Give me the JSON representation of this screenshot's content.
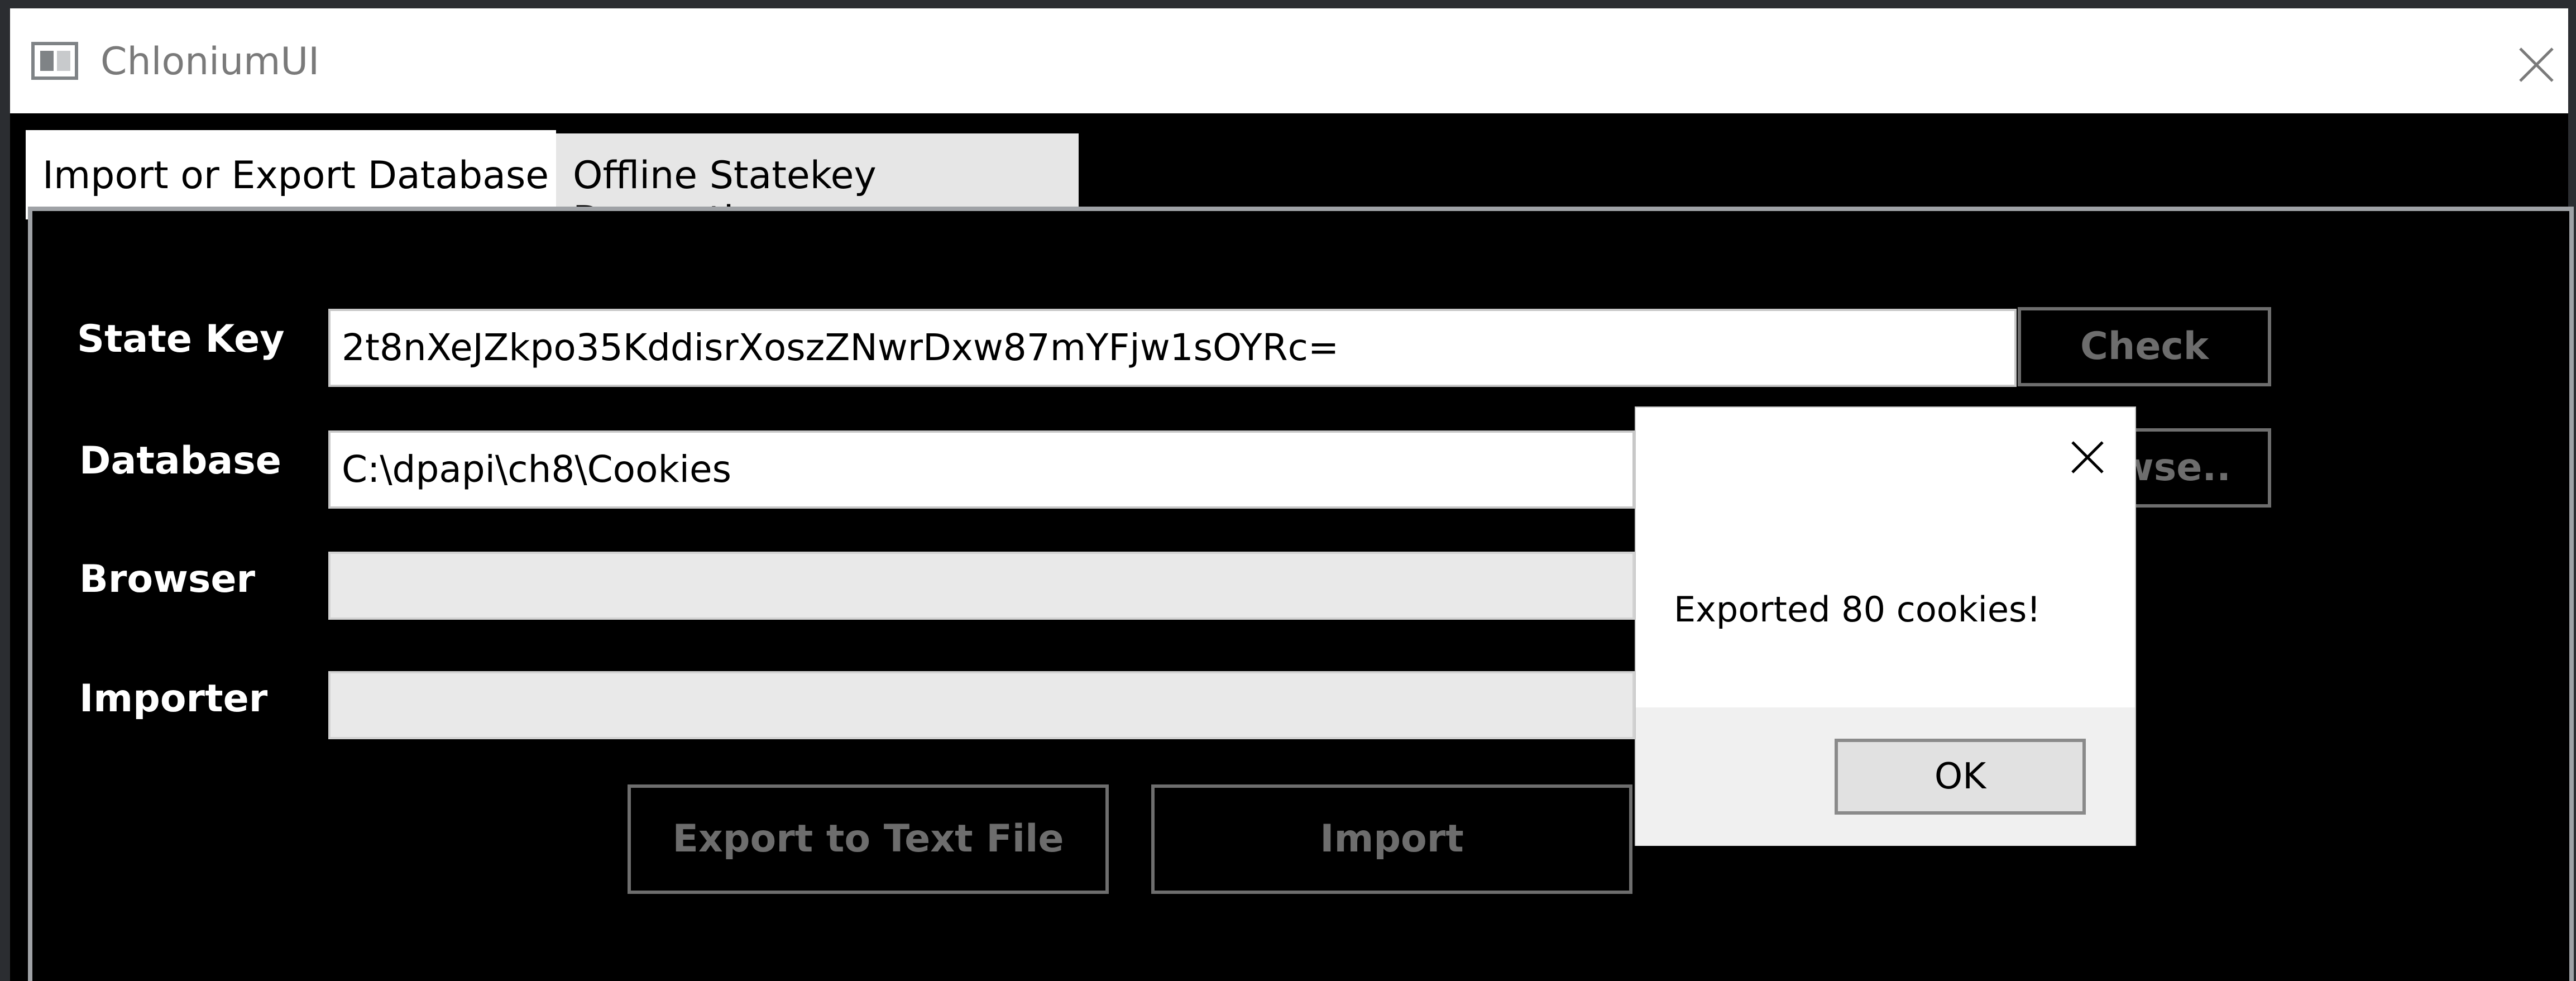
{
  "window": {
    "title": "ChloniumUI",
    "title_color": "#7a7a7a"
  },
  "icons": {
    "app": "app-window-icon",
    "close": "close-icon",
    "dialog_close": "close-icon"
  },
  "tabs": [
    {
      "label": "Import or Export Database",
      "active": true
    },
    {
      "label": "Offline Statekey Decryption",
      "active": false
    }
  ],
  "form": {
    "state_key_label": "State Key",
    "state_key_value": "2t8nXeJZkpo35KddisrXoszZNwrDxw87mYFjw1sOYRc=",
    "check_button": "Check",
    "database_label": "Database",
    "database_value": "C:\\dpapi\\ch8\\Cookies",
    "browse_button_visible": "wse..",
    "browser_label": "Browser",
    "importer_label": "Importer",
    "export_button": "Export to Text File",
    "import_button": "Import"
  },
  "dialog": {
    "message": "Exported 80 cookies!",
    "ok_button": "OK"
  },
  "colors": {
    "window_background": "#000000",
    "panel_border": "#9fa2a6",
    "disabled_button_text": "#6d6d6d"
  }
}
